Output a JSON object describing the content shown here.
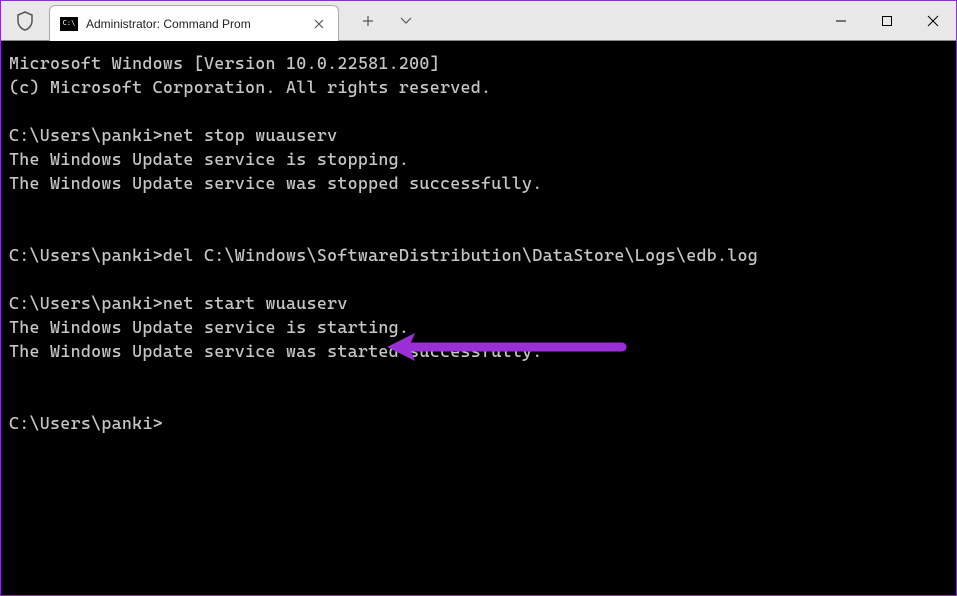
{
  "window": {
    "tab_title": "Administrator: Command Prom",
    "icon_text": "C:\\"
  },
  "terminal": {
    "lines": [
      "Microsoft Windows [Version 10.0.22581.200]",
      "(c) Microsoft Corporation. All rights reserved.",
      "",
      "C:\\Users\\panki>net stop wuauserv",
      "The Windows Update service is stopping.",
      "The Windows Update service was stopped successfully.",
      "",
      "",
      "C:\\Users\\panki>del C:\\Windows\\SoftwareDistribution\\DataStore\\Logs\\edb.log",
      "",
      "C:\\Users\\panki>net start wuauserv",
      "The Windows Update service is starting.",
      "The Windows Update service was started successfully.",
      "",
      "",
      "C:\\Users\\panki>"
    ]
  },
  "annotation": {
    "arrow_color": "#9b2fd6"
  }
}
